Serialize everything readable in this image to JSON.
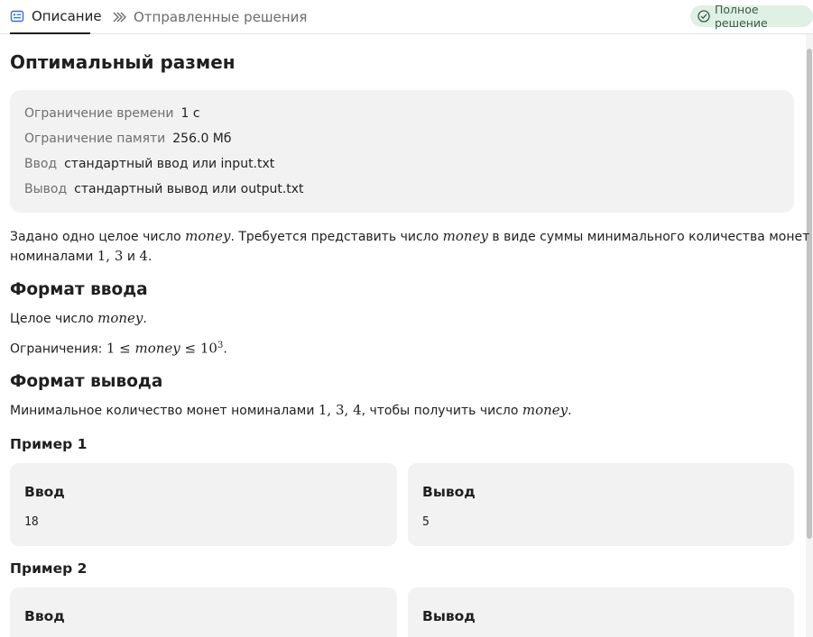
{
  "tabs": {
    "description": "Описание",
    "submissions": "Отправленные решения"
  },
  "status_badge": "Полное решение",
  "colors": {
    "badge_bg": "#dff1e5",
    "badge_fg": "#3a5c45",
    "accent": "#1f1f1f"
  },
  "icons": {
    "description_tab": "list-card-icon",
    "submissions_tab": "double-chevron-right-icon",
    "badge": "check-circle-icon"
  },
  "problem": {
    "title": "Оптимальный размен",
    "limits": [
      {
        "key": "Ограничение времени",
        "value": "1 с"
      },
      {
        "key": "Ограничение памяти",
        "value": "256.0 Мб"
      },
      {
        "key": "Ввод",
        "value": "стандартный ввод или input.txt"
      },
      {
        "key": "Вывод",
        "value": "стандартный вывод или output.txt"
      }
    ],
    "statement": {
      "t1": "Задано одно целое число ",
      "var": "money",
      "t2": ". Требуется представить число ",
      "t3": " в виде суммы минимального количества монет",
      "t4": "номиналами ",
      "n1": "1",
      "comma": ", ",
      "n3": "3",
      "and": " и ",
      "n4": "4",
      "dot": "."
    },
    "input_format": {
      "heading": "Формат ввода",
      "line1_prefix": "Целое число ",
      "constraints_prefix": "Ограничения: ",
      "one": "1",
      "leq": " ≤ ",
      "ten": "10",
      "exp": "3"
    },
    "output_format": {
      "heading": "Формат вывода",
      "prefix": "Минимальное количество монет номиналами ",
      "suffix": ", чтобы получить число "
    },
    "examples": [
      {
        "heading": "Пример 1",
        "input_label": "Ввод",
        "input": "18",
        "output_label": "Вывод",
        "output": "5"
      },
      {
        "heading": "Пример 2",
        "input_label": "Ввод",
        "output_label": "Вывод"
      }
    ]
  }
}
